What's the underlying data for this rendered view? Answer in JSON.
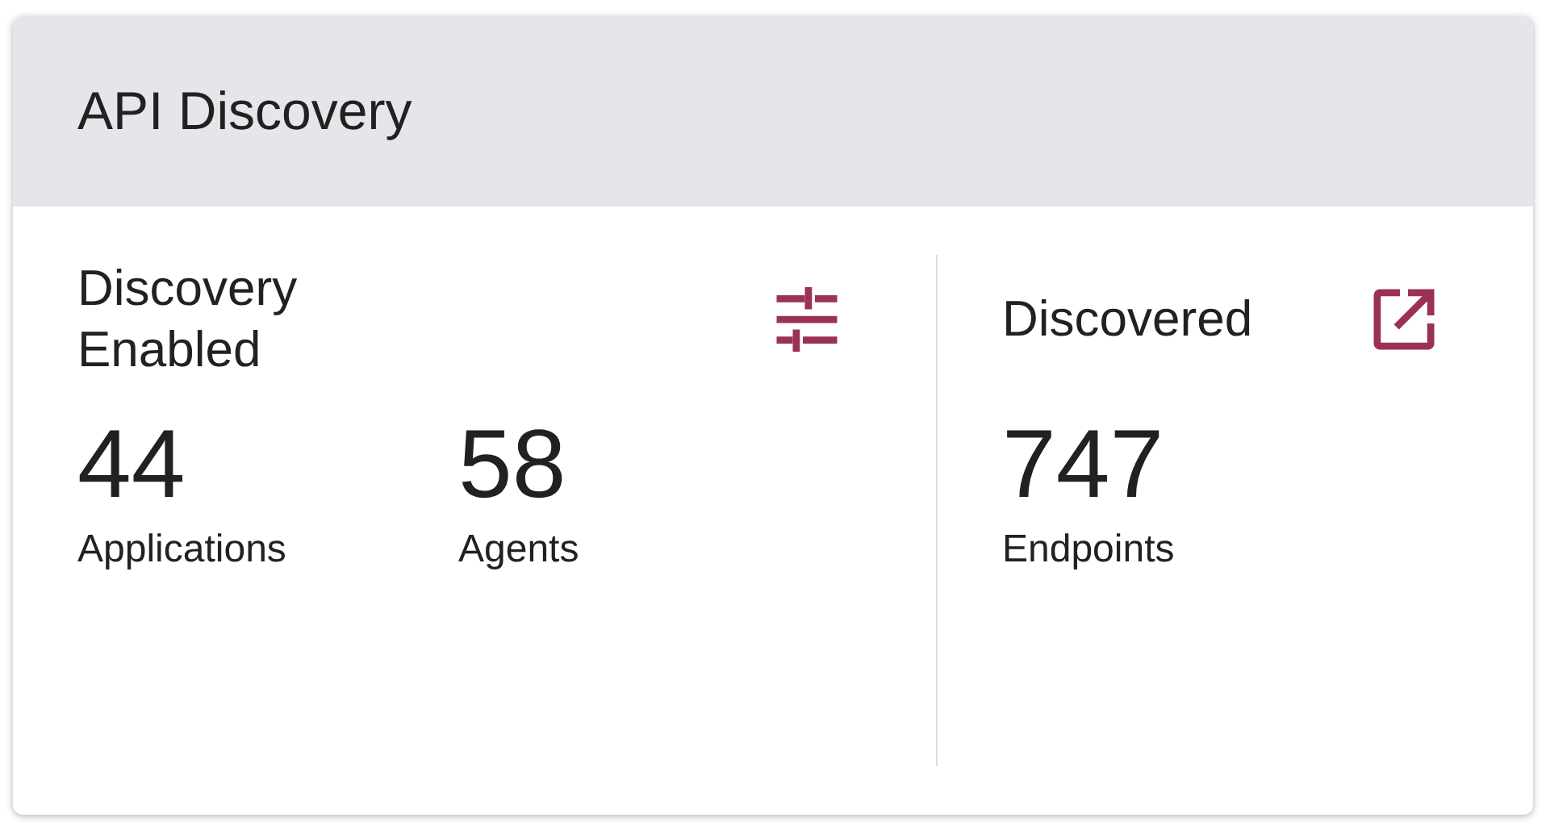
{
  "card": {
    "title": "API Discovery"
  },
  "panels": [
    {
      "title": "Discovery Enabled",
      "icon": {
        "kind": "filters"
      },
      "stats": [
        {
          "value": "44",
          "label": "Applications"
        },
        {
          "value": "58",
          "label": "Agents"
        }
      ]
    },
    {
      "title": "Discovered",
      "icon": {
        "kind": "external"
      },
      "stats": [
        {
          "value": "747",
          "label": "Endpoints"
        }
      ]
    }
  ]
}
